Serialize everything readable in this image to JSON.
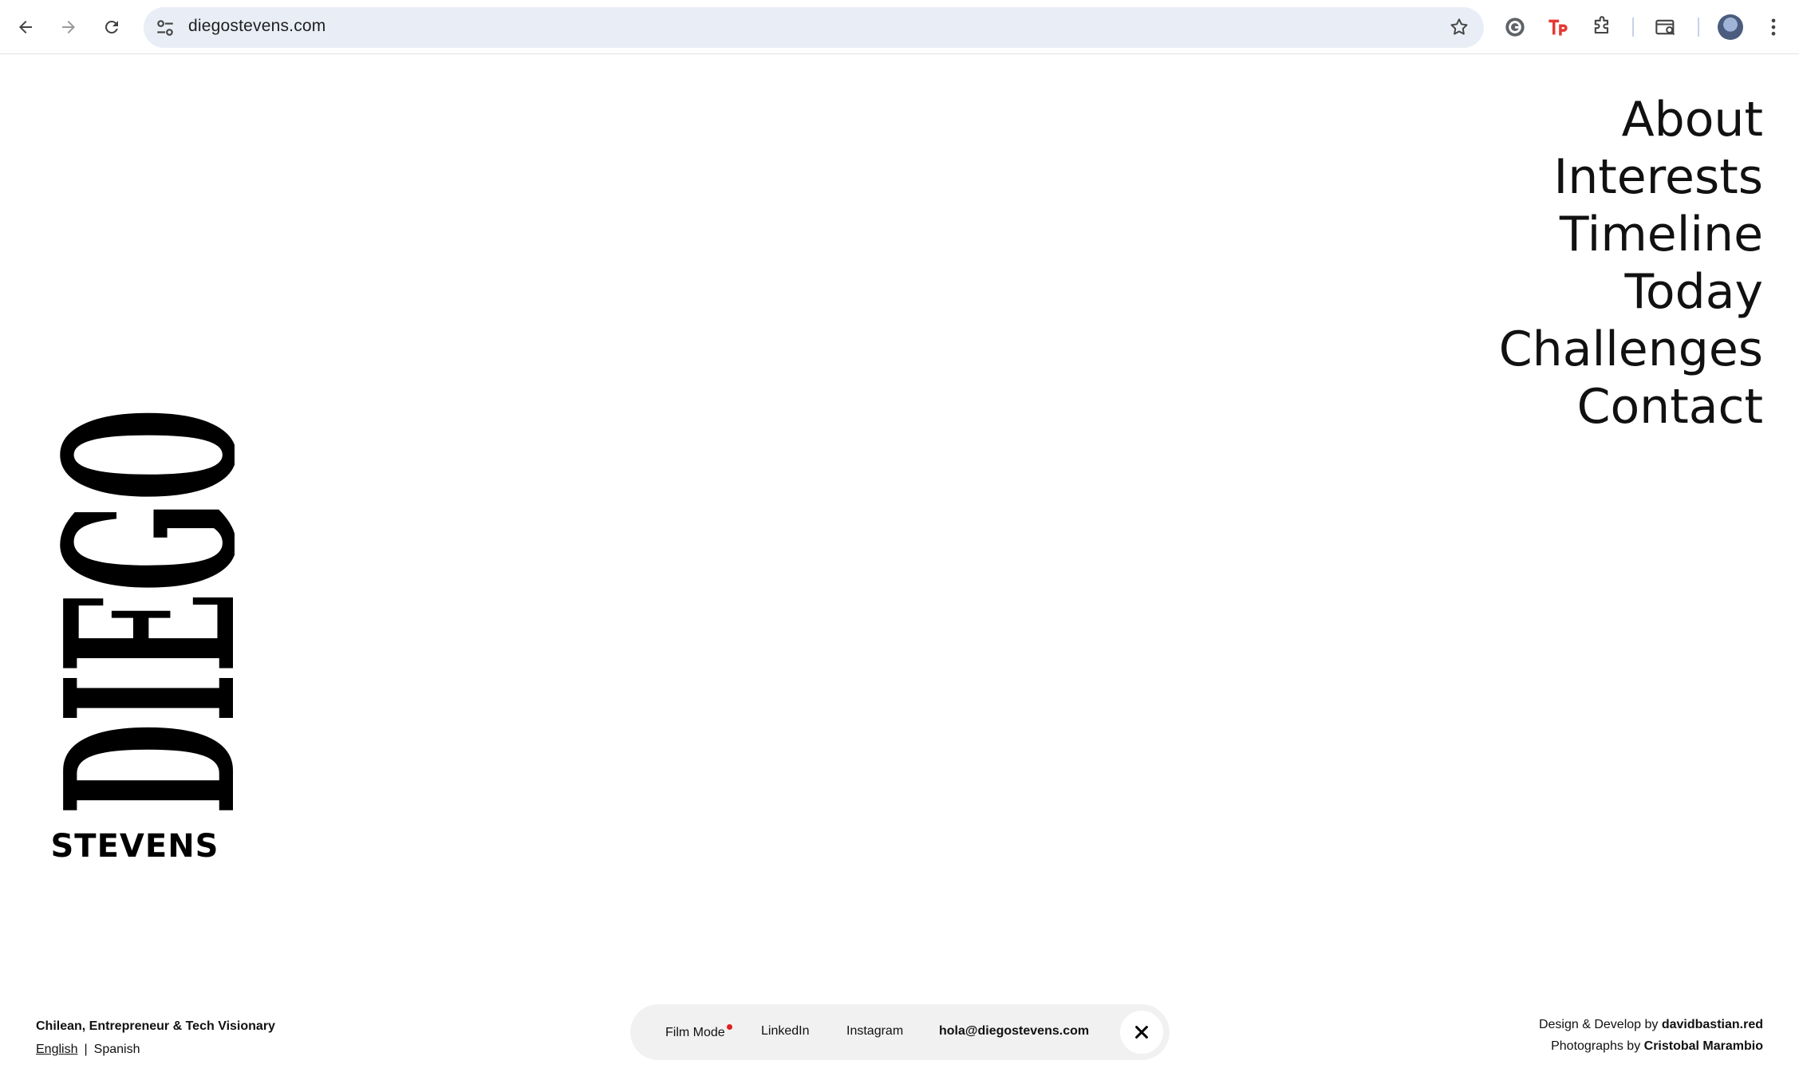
{
  "browser": {
    "url": "diegostevens.com"
  },
  "logo": {
    "top_word": "DIEGO",
    "bottom_word": "STEVENS"
  },
  "menu": {
    "items": [
      {
        "label": "About"
      },
      {
        "label": "Interests"
      },
      {
        "label": "Timeline"
      },
      {
        "label": "Today"
      },
      {
        "label": "Challenges"
      },
      {
        "label": "Contact"
      }
    ]
  },
  "footer": {
    "tagline": "Chilean, Entrepreneur & Tech Visionary",
    "languages": {
      "english": "English",
      "separator": "|",
      "spanish": "Spanish"
    },
    "pill": {
      "film_mode": "Film Mode",
      "linkedin": "LinkedIn",
      "instagram": "Instagram",
      "email": "hola@diegostevens.com"
    },
    "credits": {
      "design_prefix": "Design & Develop by",
      "design_name": "davidbastian.red",
      "photo_prefix": "Photographs by",
      "photo_name": "Cristobal Marambio"
    }
  },
  "colors": {
    "accent_dot": "#e02020",
    "omnibox_bg": "#e9eef6",
    "pill_bg": "#f1f1f1"
  }
}
